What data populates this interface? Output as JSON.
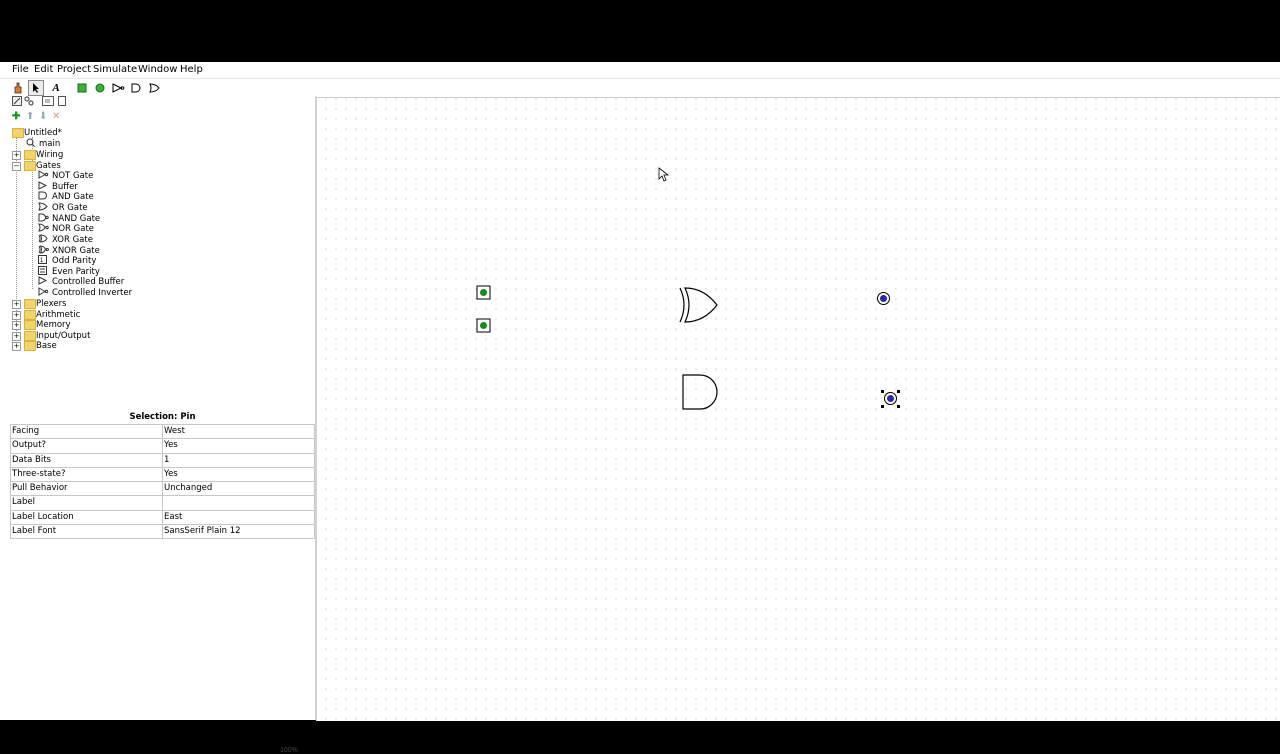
{
  "menu": [
    "File",
    "Edit",
    "Project",
    "Simulate",
    "Window",
    "Help"
  ],
  "tree": {
    "root": "Untitled*",
    "main": "main",
    "wiring": "Wiring",
    "gates": "Gates",
    "gate_items": [
      "NOT Gate",
      "Buffer",
      "AND Gate",
      "OR Gate",
      "NAND Gate",
      "NOR Gate",
      "XOR Gate",
      "XNOR Gate",
      "Odd Parity",
      "Even Parity",
      "Controlled Buffer",
      "Controlled Inverter"
    ],
    "folders": [
      "Plexers",
      "Arithmetic",
      "Memory",
      "Input/Output",
      "Base"
    ]
  },
  "selection": {
    "title": "Selection: Pin",
    "rows": [
      {
        "key": "Facing",
        "value": "West"
      },
      {
        "key": "Output?",
        "value": "Yes"
      },
      {
        "key": "Data Bits",
        "value": "1"
      },
      {
        "key": "Three-state?",
        "value": "Yes"
      },
      {
        "key": "Pull Behavior",
        "value": "Unchanged"
      },
      {
        "key": "Label",
        "value": ""
      },
      {
        "key": "Label Location",
        "value": "East"
      },
      {
        "key": "Label Font",
        "value": "SansSerif Plain 12"
      }
    ]
  },
  "zoom_label": "100%",
  "colors": {
    "input_pin": "#1a8a1a",
    "output_pin": "#2a2aa8",
    "folder": "#f3d46b"
  }
}
